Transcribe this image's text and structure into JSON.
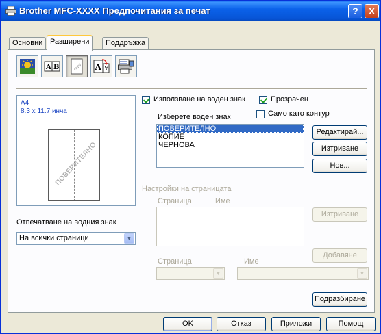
{
  "window": {
    "title": "Brother MFC-XXXX Предпочитания за печат",
    "help_label": "?",
    "close_label": "X"
  },
  "tabs": [
    {
      "label": "Основни"
    },
    {
      "label": "Разширени",
      "active": true
    },
    {
      "label": "Поддръжка"
    }
  ],
  "toolbar_icons": [
    "color-quality-icon",
    "scaling-icon",
    "watermark-icon",
    "page-setting-icon",
    "device-options-icon"
  ],
  "preview": {
    "paper_name": "A4",
    "paper_size": "8.3 x 11.7 инча",
    "watermark_text": "ПОВЕРИТЕЛНО"
  },
  "print_watermark": {
    "label": "Отпечатване на водния знак",
    "selected": "На всички страници"
  },
  "use_watermark": {
    "label": "Използване на воден знак",
    "checked": true
  },
  "transparent": {
    "label": "Прозрачен",
    "checked": true
  },
  "outline_only": {
    "label": "Само като контур",
    "checked": false
  },
  "select_watermark": {
    "label": "Изберете воден знак",
    "items": [
      "ПОВЕРИТЕЛНО",
      "КОПИЕ",
      "ЧЕРНОВА"
    ],
    "selected_index": 0
  },
  "buttons": {
    "edit": "Редактирай...",
    "delete": "Изтриване",
    "new": "Нов..."
  },
  "page_settings": {
    "title": "Настройки на страницата",
    "col_page": "Страница",
    "col_name": "Име",
    "delete": "Изтриване",
    "page_label": "Страница",
    "name_label": "Име",
    "add": "Добавяне"
  },
  "default_button": "Подразбиране",
  "footer": {
    "ok": "OK",
    "cancel": "Отказ",
    "apply": "Приложи",
    "help": "Помощ"
  },
  "colors": {
    "title_bar": "#0754d6",
    "selection": "#316ac5",
    "dialog_bg": "#ece9d8"
  }
}
